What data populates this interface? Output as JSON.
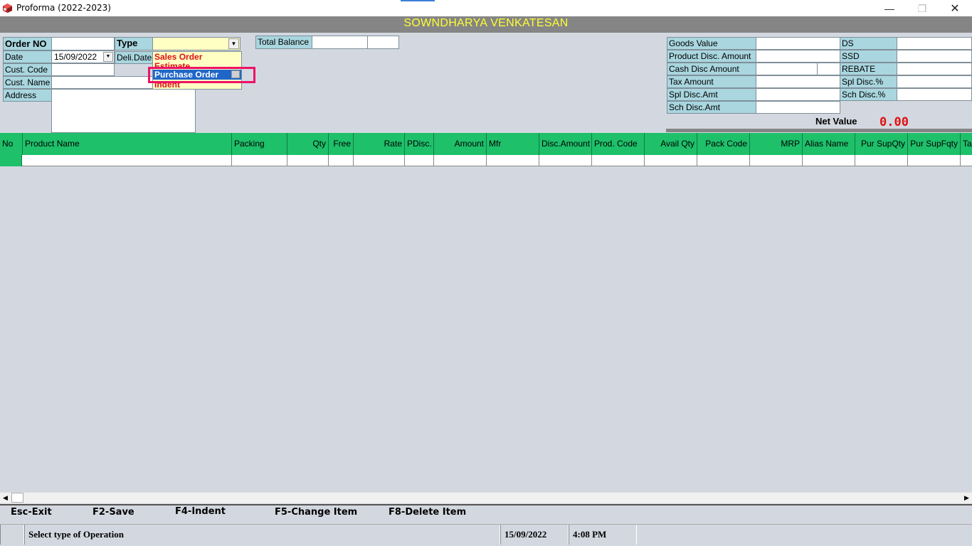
{
  "window": {
    "title": "Proforma (2022-2023)",
    "minimize_glyph": "—",
    "maximize_glyph": "❐",
    "close_glyph": "✕"
  },
  "company": {
    "name": "SOWNDHARYA VENKATESAN"
  },
  "order": {
    "order_no_label": "Order NO",
    "order_no_value": "",
    "type_label": "Type",
    "type_value": "",
    "date_label": "Date",
    "date_value": "15/09/2022",
    "deli_date_label": "Deli.Date",
    "cust_code_label": "Cust. Code",
    "cust_name_label": "Cust. Name",
    "address_label": "Address",
    "total_balance_label": "Total Balance"
  },
  "type_options": [
    {
      "label": "Sales Order",
      "selected": false
    },
    {
      "label": "Estimate",
      "selected": false
    },
    {
      "label": "Purchase Order",
      "selected": true
    },
    {
      "label": "Indent",
      "selected": false
    }
  ],
  "totals": {
    "goods_value_label": "Goods Value",
    "product_disc_label": "Product Disc. Amount",
    "cash_disc_label": "Cash Disc Amount",
    "tax_amount_label": "Tax Amount",
    "spl_disc_amt_label": "Spl Disc.Amt",
    "sch_disc_amt_label": "Sch Disc.Amt",
    "ds_label": "DS",
    "ssd_label": "SSD",
    "rebate_label": "REBATE",
    "spl_disc_pct_label": "Spl Disc.%",
    "sch_disc_pct_label": "Sch Disc.%",
    "net_value_label": "Net Value",
    "net_value": "0.00"
  },
  "grid": {
    "columns": [
      "No",
      "Product Name",
      "Packing",
      "Qty",
      "Free",
      "Rate",
      "PDisc.",
      "Amount",
      "Mfr",
      "Disc.Amount",
      "Prod. Code",
      "Avail Qty",
      "Pack Code",
      "MRP",
      "Alias Name",
      "Pur SupQty",
      "Pur SupFqty",
      "Ta"
    ]
  },
  "shortcuts": [
    "Esc-Exit",
    "F2-Save",
    "F4-Indent",
    "F5-Change Item",
    "F8-Delete Item"
  ],
  "status": {
    "message": "Select type of Operation",
    "date": "15/09/2022",
    "time": "4:08 PM"
  },
  "colors": {
    "header_band": "#858585",
    "company_text": "#ffff33",
    "label_bg": "#a9d6df",
    "grid_header": "#1ec06a",
    "selection": "#1f66c8",
    "highlight_box": "#ee1166",
    "red_text": "#dd1111"
  }
}
